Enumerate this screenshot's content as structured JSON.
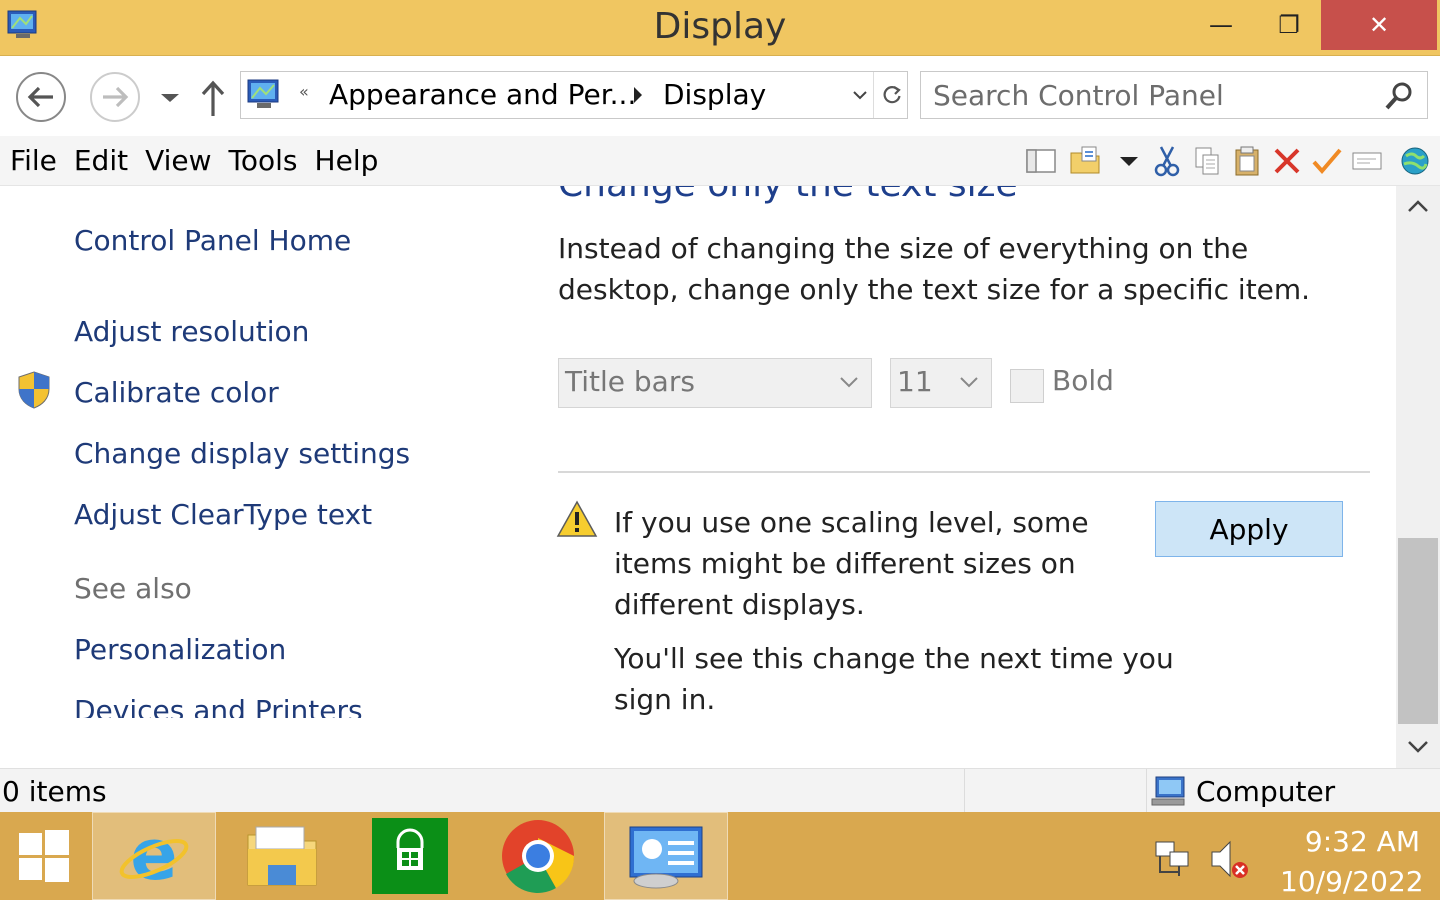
{
  "window": {
    "title": "Display",
    "minimize_glyph": "—",
    "maximize_glyph": "❐",
    "close_glyph": "✕"
  },
  "address_bar": {
    "overflow_glyph": "«",
    "crumbs": [
      "Appearance and Per...",
      "Display"
    ]
  },
  "search": {
    "placeholder": "Search Control Panel"
  },
  "menu": {
    "items": [
      "File",
      "Edit",
      "View",
      "Tools",
      "Help"
    ]
  },
  "toolbar_icons": [
    "layout-pane-icon",
    "properties-icon",
    "dropdown-arrow-icon",
    "cut-icon",
    "copy-icon",
    "paste-icon",
    "delete-icon",
    "checkmark-icon",
    "rename-icon",
    "globe-icon"
  ],
  "left_pane": {
    "home_link": "Control Panel Home",
    "tasks": [
      "Adjust resolution",
      "Calibrate color",
      "Change display settings",
      "Adjust ClearType text"
    ],
    "see_also_heading": "See also",
    "see_also_links": [
      "Personalization",
      "Devices and Printers"
    ]
  },
  "main": {
    "section_title": "Change only the text size",
    "description": "Instead of changing the size of everything on the desktop, change only the text size for a specific item.",
    "item_select": "Title bars",
    "size_select": "11",
    "bold_label": "Bold",
    "bold_checked": false,
    "warning": "If you use one scaling level, some items might be different sizes on different displays.",
    "note": "You'll see this change the next time you sign in.",
    "apply_label": "Apply"
  },
  "status_bar": {
    "items_count": "0 items",
    "location": "Computer"
  },
  "taskbar": {
    "apps": [
      "start",
      "internet-explorer",
      "file-explorer",
      "store",
      "chrome",
      "control-panel"
    ],
    "active_app": "control-panel",
    "time": "9:32 AM",
    "date": "10/9/2022"
  },
  "colors": {
    "title_bar": "#f0c661",
    "close_button": "#c7504b",
    "taskbar": "#d9a84f",
    "link": "#1e3a78",
    "section_title": "#1e3f8c",
    "apply_button": "#cde5f7"
  }
}
